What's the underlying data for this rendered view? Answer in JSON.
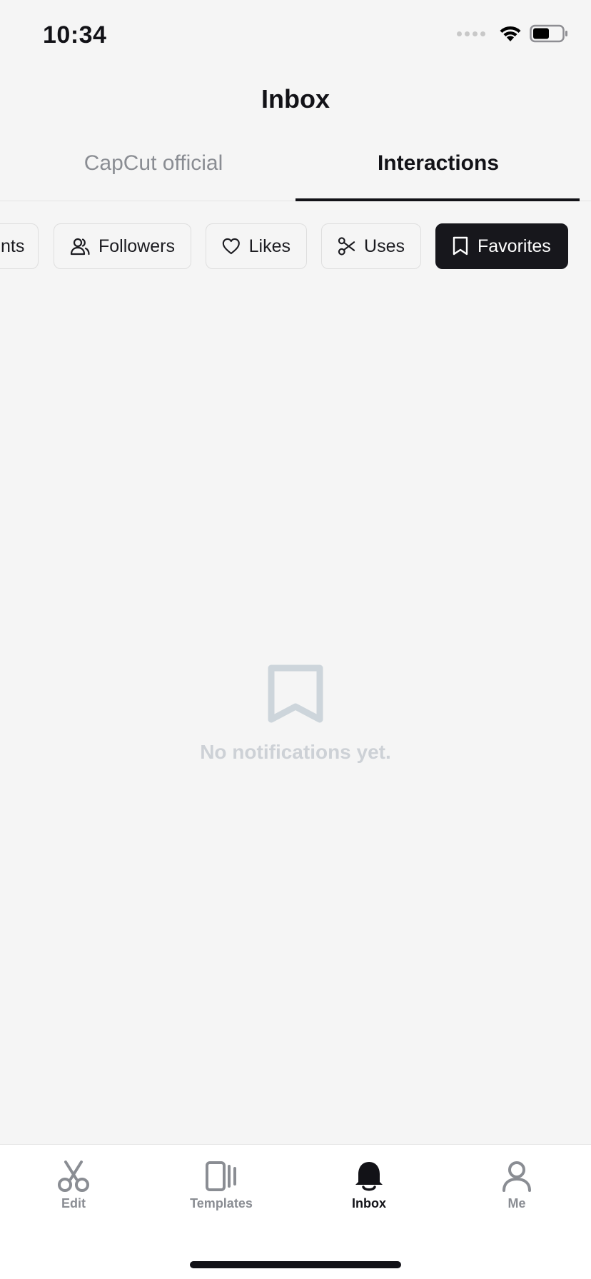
{
  "status_bar": {
    "time": "10:34"
  },
  "header": {
    "title": "Inbox"
  },
  "tabs": [
    {
      "label": "CapCut official",
      "active": false
    },
    {
      "label": "Interactions",
      "active": true
    }
  ],
  "filters": [
    {
      "label": "nts",
      "icon": "comment-icon",
      "active": false
    },
    {
      "label": "Followers",
      "icon": "followers-icon",
      "active": false
    },
    {
      "label": "Likes",
      "icon": "heart-icon",
      "active": false
    },
    {
      "label": "Uses",
      "icon": "scissors-icon",
      "active": false
    },
    {
      "label": "Favorites",
      "icon": "bookmark-icon",
      "active": true
    }
  ],
  "empty_state": {
    "icon": "bookmark-icon",
    "message": "No notifications yet."
  },
  "bottom_nav": [
    {
      "label": "Edit",
      "icon": "scissors-icon",
      "active": false
    },
    {
      "label": "Templates",
      "icon": "templates-icon",
      "active": false
    },
    {
      "label": "Inbox",
      "icon": "bell-icon",
      "active": true
    },
    {
      "label": "Me",
      "icon": "person-icon",
      "active": false
    }
  ],
  "colors": {
    "background": "#f5f5f5",
    "primary_text": "#121217",
    "muted_text": "#8a8d93",
    "active_chip": "#17171c",
    "empty_state": "#cdd1d6"
  }
}
